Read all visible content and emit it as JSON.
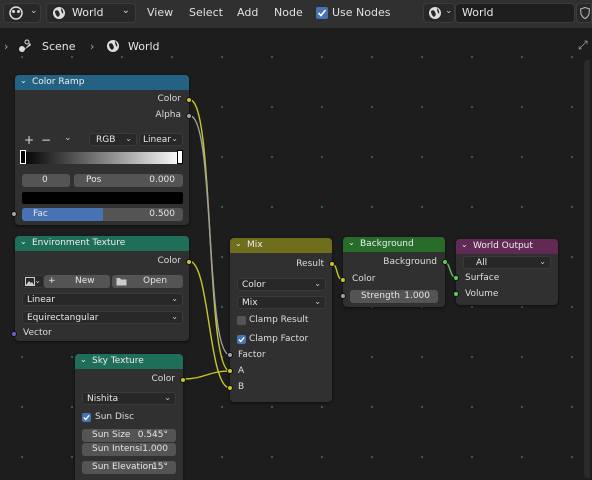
{
  "header": {
    "editor_type_icon": "node-editor-icon",
    "world_selector": {
      "icon": "world-icon",
      "value": "World"
    },
    "menus": [
      "View",
      "Select",
      "Add",
      "Node"
    ],
    "use_nodes": {
      "label": "Use Nodes",
      "checked": true
    },
    "world_datablock": {
      "icon": "world-icon",
      "value": "World"
    }
  },
  "breadcrumb": {
    "scene": "Scene",
    "world": "World"
  },
  "nodes": {
    "color_ramp": {
      "title": "Color Ramp",
      "out_color": "Color",
      "out_alpha": "Alpha",
      "add": "+",
      "remove": "−",
      "color_mode": "RGB",
      "interpolation": "Linear",
      "stop_index": "0",
      "pos_label": "Pos",
      "pos_value": "0.000",
      "fac_label": "Fac",
      "fac_value": "0.500",
      "fac_fraction": 0.5
    },
    "environment_texture": {
      "title": "Environment Texture",
      "out_color": "Color",
      "new_label": "New",
      "open_label": "Open",
      "interpolation": "Linear",
      "projection": "Equirectangular",
      "in_vector": "Vector"
    },
    "sky_texture": {
      "title": "Sky Texture",
      "out_color": "Color",
      "sky_type": "Nishita",
      "sun_disc": {
        "label": "Sun Disc",
        "checked": true
      },
      "sun_size": {
        "label": "Sun Size",
        "value": "0.545°"
      },
      "sun_intensity": {
        "label": "Sun Intensi",
        "value": "1.000"
      },
      "sun_elevation": {
        "label": "Sun Elevation",
        "value": "15°"
      }
    },
    "mix": {
      "title": "Mix",
      "out_result": "Result",
      "data_type": "Color",
      "blend_type": "Mix",
      "clamp_result": {
        "label": "Clamp Result",
        "checked": false
      },
      "clamp_factor": {
        "label": "Clamp Factor",
        "checked": true
      },
      "in_factor": "Factor",
      "in_a": "A",
      "in_b": "B"
    },
    "background": {
      "title": "Background",
      "out_background": "Background",
      "in_color": "Color",
      "strength_label": "Strength",
      "strength_value": "1.000"
    },
    "world_output": {
      "title": "World Output",
      "target": "All",
      "in_surface": "Surface",
      "in_volume": "Volume"
    }
  },
  "colors": {
    "converter_header": "#246283",
    "texture_header": "#1e6e5a",
    "color_header": "#6e6e1d",
    "shader_header": "#286c2a",
    "output_header": "#602a55",
    "wire": "#c7c729",
    "wire_gray": "#a1a1a1",
    "accent": "#4772b3"
  }
}
